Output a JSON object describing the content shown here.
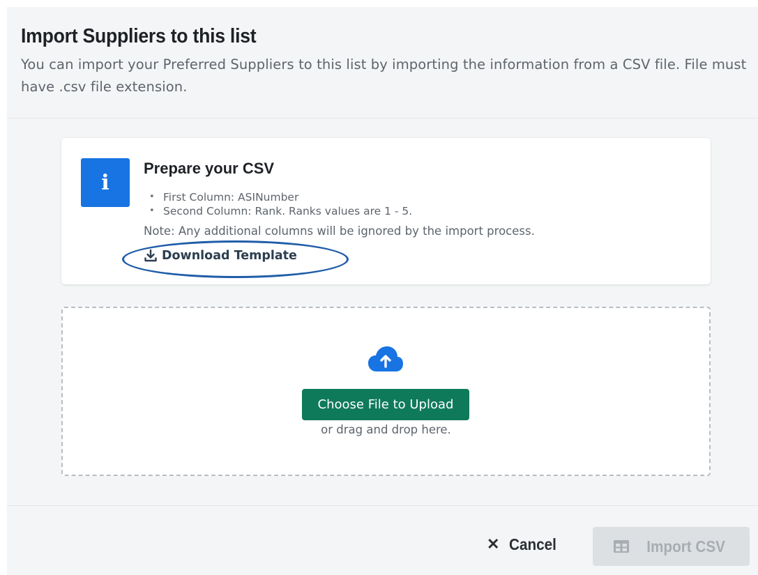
{
  "header": {
    "title": "Import Suppliers to this list",
    "description": "You can import your Preferred Suppliers to this list by importing the information from a CSV file. File must have .csv file extension."
  },
  "info_card": {
    "icon": "info-icon",
    "icon_glyph": "i",
    "title": "Prepare your CSV",
    "bullets": [
      "First Column: ASINumber",
      "Second Column: Rank. Ranks values are 1 - 5."
    ],
    "note": "Note: Any additional columns will be ignored by the import process.",
    "download_label": "Download Template",
    "download_icon": "download-icon"
  },
  "dropzone": {
    "icon": "cloud-upload-icon",
    "choose_label": "Choose File to Upload",
    "drag_text": "or drag and drop here."
  },
  "footer": {
    "cancel_label": "Cancel",
    "cancel_icon": "close-icon",
    "import_label": "Import CSV",
    "import_icon": "table-icon",
    "import_disabled": true
  },
  "colors": {
    "info_blue": "#1774e2",
    "primary_green": "#0f7a5a",
    "annotation_oval": "#1f5da8",
    "disabled_bg": "#dde0e3",
    "disabled_text": "#a8adb2",
    "panel_bg": "#f4f5f6"
  }
}
